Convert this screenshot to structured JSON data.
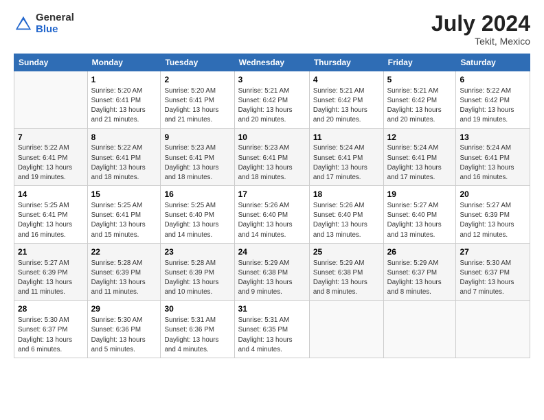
{
  "header": {
    "logo_line1": "General",
    "logo_line2": "Blue",
    "month_year": "July 2024",
    "location": "Tekit, Mexico"
  },
  "days_of_week": [
    "Sunday",
    "Monday",
    "Tuesday",
    "Wednesday",
    "Thursday",
    "Friday",
    "Saturday"
  ],
  "weeks": [
    [
      {
        "day": "",
        "info": ""
      },
      {
        "day": "1",
        "info": "Sunrise: 5:20 AM\nSunset: 6:41 PM\nDaylight: 13 hours\nand 21 minutes."
      },
      {
        "day": "2",
        "info": "Sunrise: 5:20 AM\nSunset: 6:41 PM\nDaylight: 13 hours\nand 21 minutes."
      },
      {
        "day": "3",
        "info": "Sunrise: 5:21 AM\nSunset: 6:42 PM\nDaylight: 13 hours\nand 20 minutes."
      },
      {
        "day": "4",
        "info": "Sunrise: 5:21 AM\nSunset: 6:42 PM\nDaylight: 13 hours\nand 20 minutes."
      },
      {
        "day": "5",
        "info": "Sunrise: 5:21 AM\nSunset: 6:42 PM\nDaylight: 13 hours\nand 20 minutes."
      },
      {
        "day": "6",
        "info": "Sunrise: 5:22 AM\nSunset: 6:42 PM\nDaylight: 13 hours\nand 19 minutes."
      }
    ],
    [
      {
        "day": "7",
        "info": ""
      },
      {
        "day": "8",
        "info": "Sunrise: 5:22 AM\nSunset: 6:41 PM\nDaylight: 13 hours\nand 18 minutes."
      },
      {
        "day": "9",
        "info": "Sunrise: 5:23 AM\nSunset: 6:41 PM\nDaylight: 13 hours\nand 18 minutes."
      },
      {
        "day": "10",
        "info": "Sunrise: 5:23 AM\nSunset: 6:41 PM\nDaylight: 13 hours\nand 18 minutes."
      },
      {
        "day": "11",
        "info": "Sunrise: 5:24 AM\nSunset: 6:41 PM\nDaylight: 13 hours\nand 17 minutes."
      },
      {
        "day": "12",
        "info": "Sunrise: 5:24 AM\nSunset: 6:41 PM\nDaylight: 13 hours\nand 17 minutes."
      },
      {
        "day": "13",
        "info": "Sunrise: 5:24 AM\nSunset: 6:41 PM\nDaylight: 13 hours\nand 16 minutes."
      }
    ],
    [
      {
        "day": "14",
        "info": ""
      },
      {
        "day": "15",
        "info": "Sunrise: 5:25 AM\nSunset: 6:41 PM\nDaylight: 13 hours\nand 15 minutes."
      },
      {
        "day": "16",
        "info": "Sunrise: 5:25 AM\nSunset: 6:40 PM\nDaylight: 13 hours\nand 14 minutes."
      },
      {
        "day": "17",
        "info": "Sunrise: 5:26 AM\nSunset: 6:40 PM\nDaylight: 13 hours\nand 14 minutes."
      },
      {
        "day": "18",
        "info": "Sunrise: 5:26 AM\nSunset: 6:40 PM\nDaylight: 13 hours\nand 13 minutes."
      },
      {
        "day": "19",
        "info": "Sunrise: 5:27 AM\nSunset: 6:40 PM\nDaylight: 13 hours\nand 13 minutes."
      },
      {
        "day": "20",
        "info": "Sunrise: 5:27 AM\nSunset: 6:39 PM\nDaylight: 13 hours\nand 12 minutes."
      }
    ],
    [
      {
        "day": "21",
        "info": ""
      },
      {
        "day": "22",
        "info": "Sunrise: 5:28 AM\nSunset: 6:39 PM\nDaylight: 13 hours\nand 11 minutes."
      },
      {
        "day": "23",
        "info": "Sunrise: 5:28 AM\nSunset: 6:39 PM\nDaylight: 13 hours\nand 10 minutes."
      },
      {
        "day": "24",
        "info": "Sunrise: 5:29 AM\nSunset: 6:38 PM\nDaylight: 13 hours\nand 9 minutes."
      },
      {
        "day": "25",
        "info": "Sunrise: 5:29 AM\nSunset: 6:38 PM\nDaylight: 13 hours\nand 8 minutes."
      },
      {
        "day": "26",
        "info": "Sunrise: 5:29 AM\nSunset: 6:37 PM\nDaylight: 13 hours\nand 8 minutes."
      },
      {
        "day": "27",
        "info": "Sunrise: 5:30 AM\nSunset: 6:37 PM\nDaylight: 13 hours\nand 7 minutes."
      }
    ],
    [
      {
        "day": "28",
        "info": "Sunrise: 5:30 AM\nSunset: 6:37 PM\nDaylight: 13 hours\nand 6 minutes."
      },
      {
        "day": "29",
        "info": "Sunrise: 5:30 AM\nSunset: 6:36 PM\nDaylight: 13 hours\nand 5 minutes."
      },
      {
        "day": "30",
        "info": "Sunrise: 5:31 AM\nSunset: 6:36 PM\nDaylight: 13 hours\nand 4 minutes."
      },
      {
        "day": "31",
        "info": "Sunrise: 5:31 AM\nSunset: 6:35 PM\nDaylight: 13 hours\nand 4 minutes."
      },
      {
        "day": "",
        "info": ""
      },
      {
        "day": "",
        "info": ""
      },
      {
        "day": "",
        "info": ""
      }
    ]
  ],
  "week7_sunday_info": "Sunrise: 5:22 AM\nSunset: 6:41 PM\nDaylight: 13 hours\nand 19 minutes.",
  "week14_sunday_info": "Sunrise: 5:25 AM\nSunset: 6:41 PM\nDaylight: 13 hours\nand 16 minutes.",
  "week21_sunday_info": "Sunrise: 5:27 AM\nSunset: 6:39 PM\nDaylight: 13 hours\nand 11 minutes."
}
